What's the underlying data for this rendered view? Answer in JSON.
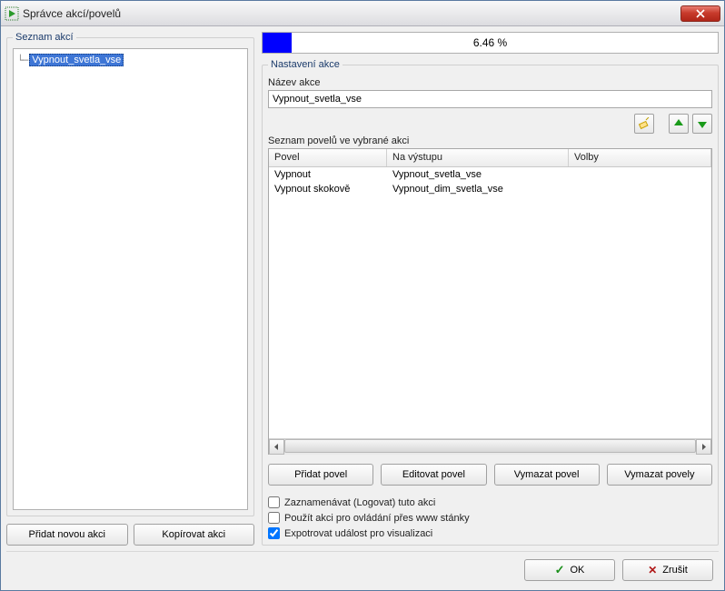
{
  "window": {
    "title": "Správce akcí/povelů"
  },
  "left": {
    "group_label": "Seznam akcí",
    "items": [
      "Vypnout_svetla_vse"
    ],
    "btn_add": "Přidat novou akci",
    "btn_copy": "Kopírovat akci"
  },
  "progress": {
    "percent": 6.46,
    "label": "6.46 %"
  },
  "settings": {
    "group_label": "Nastavení akce",
    "name_label": "Název akce",
    "name_value": "Vypnout_svetla_vse",
    "list_label": "Seznam povelů ve vybrané akci",
    "columns": {
      "povel": "Povel",
      "na": "Na výstupu",
      "volby": "Volby"
    },
    "rows": [
      {
        "povel": "Vypnout",
        "na": "Vypnout_svetla_vse",
        "volby": ""
      },
      {
        "povel": "Vypnout skokově",
        "na": "Vypnout_dim_svetla_vse",
        "volby": ""
      }
    ],
    "btn_add": "Přidat povel",
    "btn_edit": "Editovat povel",
    "btn_del": "Vymazat povel",
    "btn_del_all": "Vymazat povely",
    "chk_log": "Zaznamenávat (Logovat) tuto akci",
    "chk_www": "Použít akci pro ovládání přes www stánky",
    "chk_export": "Expotrovat událost pro visualizaci",
    "chk_log_checked": false,
    "chk_www_checked": false,
    "chk_export_checked": true
  },
  "footer": {
    "ok": "OK",
    "cancel": "Zrušit"
  }
}
